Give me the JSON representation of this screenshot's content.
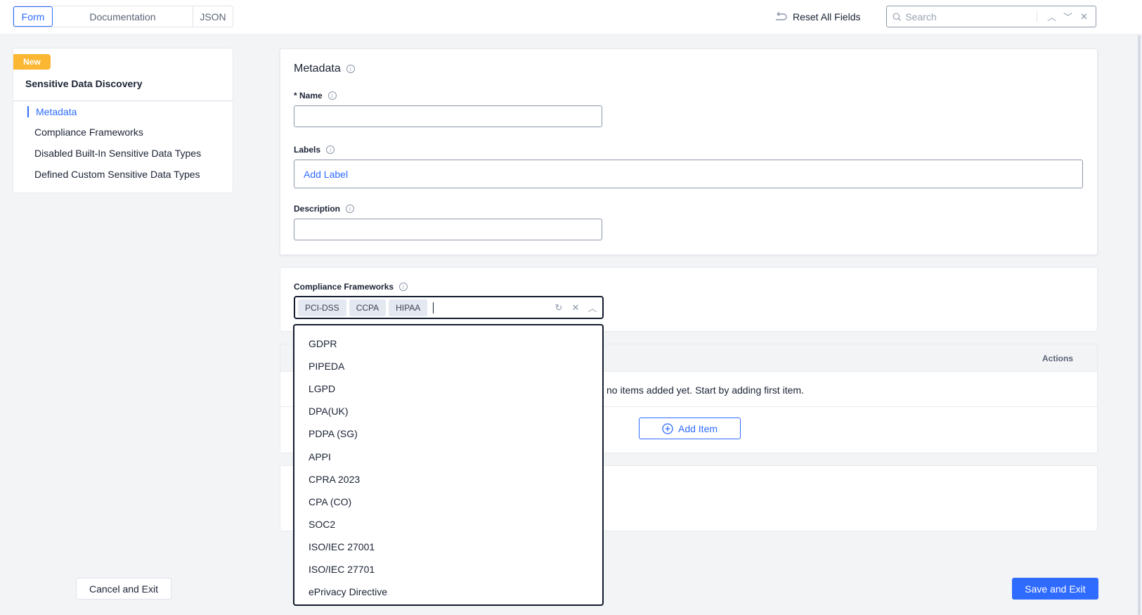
{
  "tabs": {
    "form": "Form",
    "documentation": "Documentation",
    "json": "JSON"
  },
  "toolbar": {
    "reset_label": "Reset All Fields",
    "search_placeholder": "Search"
  },
  "sidebar": {
    "badge": "New",
    "title": "Sensitive Data Discovery",
    "items": [
      {
        "label": "Metadata",
        "active": true
      },
      {
        "label": "Compliance Frameworks"
      },
      {
        "label": "Disabled Built-In Sensitive Data Types"
      },
      {
        "label": "Defined Custom Sensitive Data Types"
      }
    ]
  },
  "metadata": {
    "title": "Metadata",
    "name_label": "* Name",
    "name_value": "",
    "labels_label": "Labels",
    "add_label": "Add Label",
    "description_label": "Description",
    "description_value": ""
  },
  "compliance": {
    "label": "Compliance Frameworks",
    "selected": [
      "PCI-DSS",
      "CCPA",
      "HIPAA"
    ],
    "options": [
      "GDPR",
      "PIPEDA",
      "LGPD",
      "DPA(UK)",
      "PDPA (SG)",
      "APPI",
      "CPRA 2023",
      "CPA (CO)",
      "SOC2",
      "ISO/IEC 27001",
      "ISO/IEC 27701",
      "ePrivacy Directive"
    ]
  },
  "table": {
    "actions_header": "Actions",
    "empty_text": "no items added yet. Start by adding first item.",
    "add_item": "Add Item"
  },
  "footer": {
    "cancel": "Cancel and Exit",
    "save": "Save and Exit"
  },
  "colors": {
    "accent": "#2f6bff",
    "badge": "#fbb632"
  }
}
